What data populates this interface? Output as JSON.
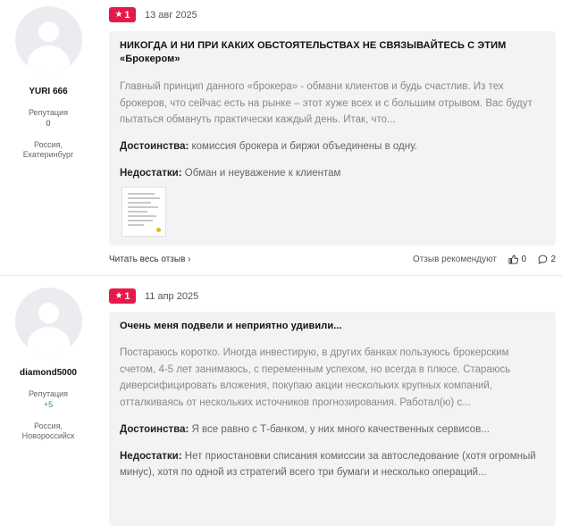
{
  "reviews": [
    {
      "author": {
        "name": "YURI 666",
        "reputation_label": "Репутация",
        "reputation": "0",
        "location_line1": "Россия,",
        "location_line2": "Екатеринбург"
      },
      "rating": "1",
      "date": "13 авг 2025",
      "title": "НИКОГДА И НИ ПРИ КАКИХ ОБСТОЯТЕЛЬСТВАХ НЕ СВЯЗЫВАЙТЕСЬ С ЭТИМ «Брокером»",
      "text": "Главный принцип данного «брокера» - обмани клиентов и будь счастлив. Из тех брокеров, что сейчас есть на рынке – этот хуже всех и с большим отрывом. Вас будут пытаться обмануть практически каждый день. Итак, что...",
      "pros_label": "Достоинства:",
      "pros": "комиссия брокера и биржи объединены в одну.",
      "cons_label": "Недостатки:",
      "cons": "Обман и неуважение к клиентам",
      "footer": {
        "read_all": "Читать весь отзыв ›",
        "recommend": "Отзыв рекомендуют",
        "likes": "0",
        "comments": "2"
      }
    },
    {
      "author": {
        "name": "diamond5000",
        "reputation_label": "Репутация",
        "reputation": "+5",
        "location_line1": "Россия,",
        "location_line2": "Новороссийск"
      },
      "rating": "1",
      "date": "11 апр 2025",
      "title": "Очень меня подвели и неприятно удивили...",
      "text": "Постараюсь коротко. Иногда инвестирую, в других банках пользуюсь брокерским счетом, 4-5 лет занимаюсь, с переменным успехом, но всегда в плюсе. Стараюсь диверсифицировать вложения, покупаю акции нескольких крупных компаний, отталкиваясь от нескольких источников прогнозирования. Работал(ю) с...",
      "pros_label": "Достоинства:",
      "pros": "Я все равно с Т-банком, у них много качественных сервисов...",
      "cons_label": "Недостатки:",
      "cons": "Нет приостановки списания комиссии за автоследование (хотя огромный минус), хотя по одной из стратегий всего три бумаги и несколько операций..."
    }
  ],
  "colors": {
    "badge": "#e6194b",
    "card_bg": "#f3f3f6",
    "positive": "#2aa146"
  }
}
